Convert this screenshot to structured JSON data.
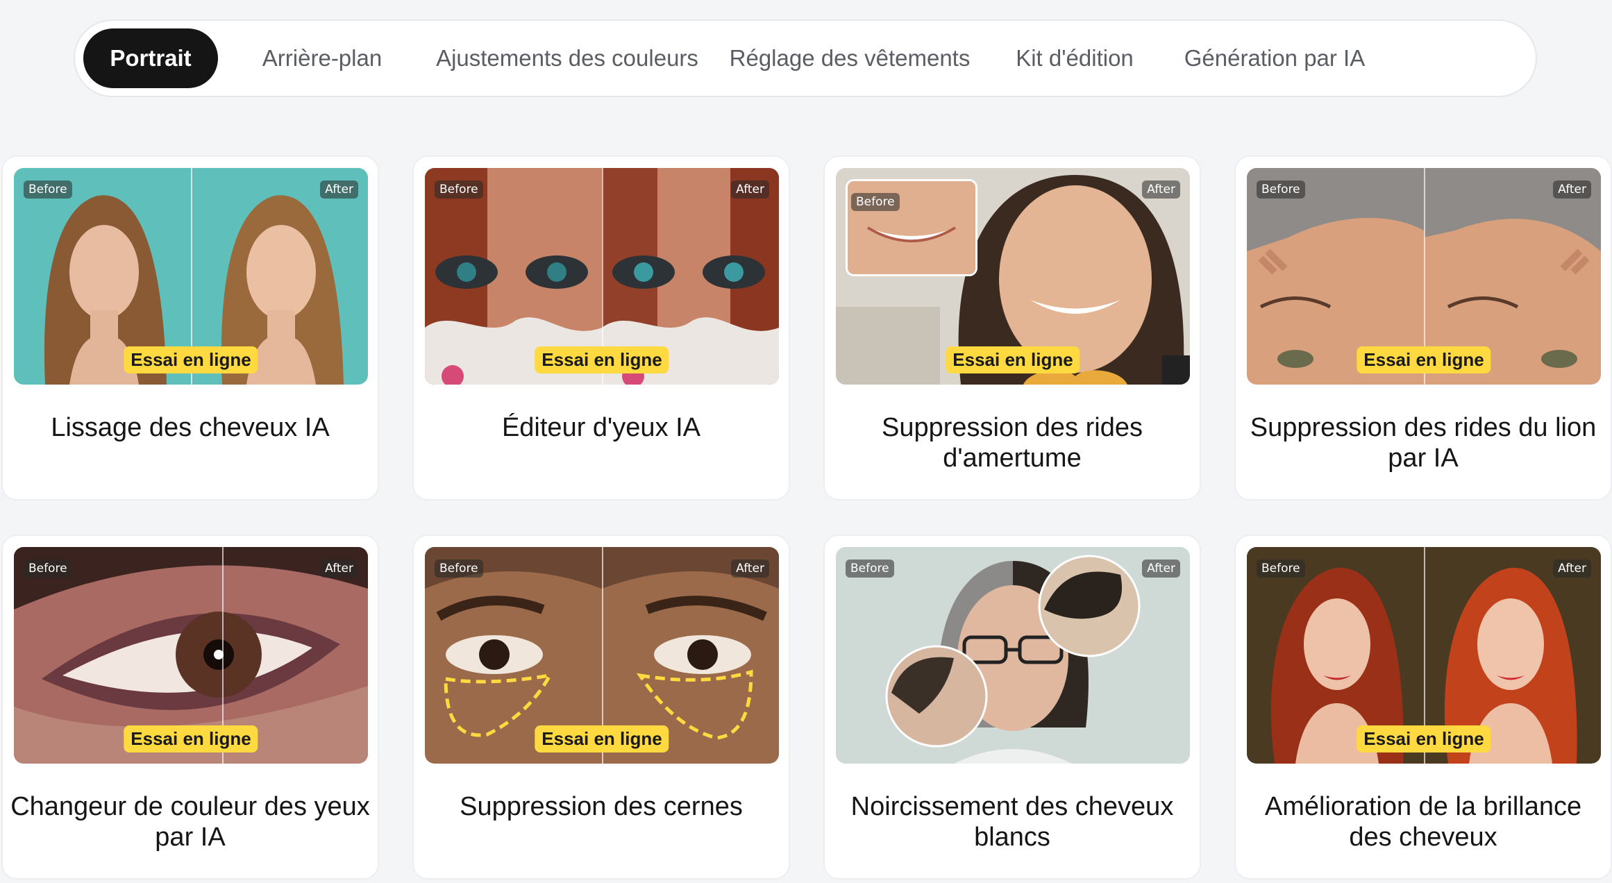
{
  "tabs": [
    {
      "label": "Portrait"
    },
    {
      "label": "Arrière-plan"
    },
    {
      "label": "Ajustements des couleurs"
    },
    {
      "label": "Réglage des vêtements"
    },
    {
      "label": "Kit d'édition"
    },
    {
      "label": "Génération par IA"
    }
  ],
  "active_tab": "Portrait",
  "badge": {
    "before": "Before",
    "after": "After",
    "try": "Essai en ligne"
  },
  "accent_color": "#ffd940",
  "cards": [
    {
      "title": "Lissage des cheveux IA"
    },
    {
      "title": "Éditeur d'yeux IA"
    },
    {
      "title": "Suppression des rides d'amertume"
    },
    {
      "title": "Suppression des rides du lion par IA"
    },
    {
      "title": "Changeur de couleur des yeux par IA"
    },
    {
      "title": "Suppression des cernes"
    },
    {
      "title": "Noircissement des cheveux blancs"
    },
    {
      "title": "Amélioration de la brillance des cheveux"
    }
  ]
}
